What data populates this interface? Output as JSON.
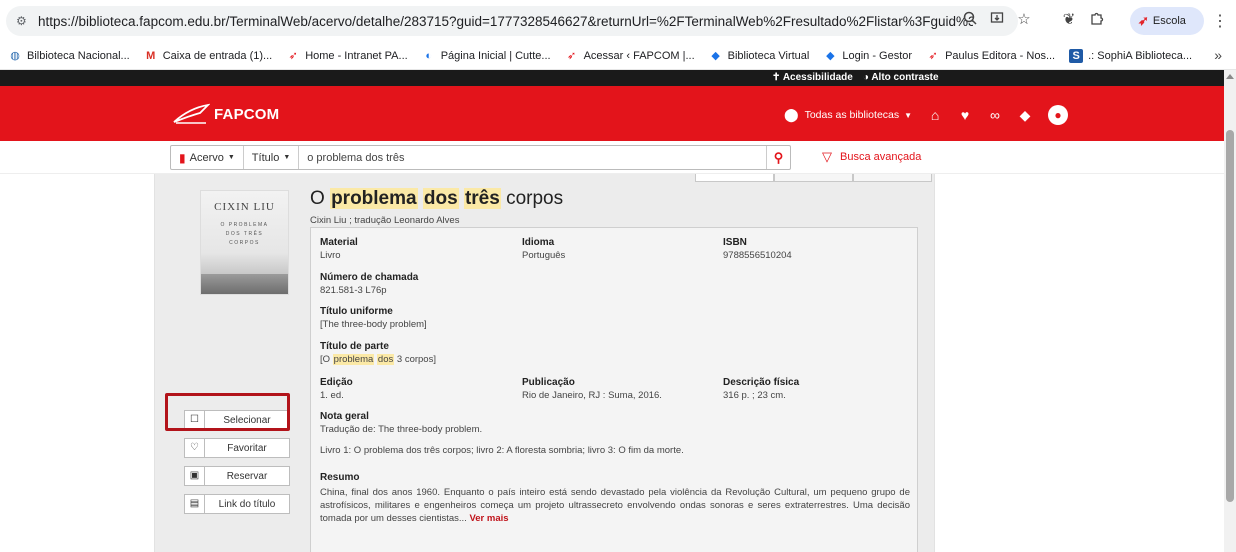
{
  "browser": {
    "url": "https://biblioteca.fapcom.edu.br/TerminalWeb/acervo/detalhe/283715?guid=1777328546627&returnUrl=%2FTerminalWeb%2Fresultado%2Flistar%3Fguid%3d177732854662...",
    "profile_label": "Escola",
    "icons": [
      "tune-icon",
      "zoom-icon",
      "install-icon",
      "star-icon",
      "extensions-icon",
      "puzzle-icon",
      "menu-kebab-icon"
    ]
  },
  "bookmarks": [
    {
      "label": "Bilbioteca Nacional...",
      "icon": "globe-icon",
      "color": "#2b6cb0"
    },
    {
      "label": "Caixa de entrada (1)...",
      "icon": "gmail-icon",
      "color": "#d93025"
    },
    {
      "label": "Home - Intranet PA...",
      "icon": "fapcom-icon",
      "color": "#e3141b"
    },
    {
      "label": "Página Inicial | Cutte...",
      "icon": "cutter-icon",
      "color": "#1a73e8"
    },
    {
      "label": "Acessar ‹ FAPCOM |...",
      "icon": "fapcom-icon",
      "color": "#e3141b"
    },
    {
      "label": "Biblioteca Virtual",
      "icon": "diamond-icon",
      "color": "#1a73e8"
    },
    {
      "label": "Login - Gestor",
      "icon": "diamond-icon",
      "color": "#1a73e8"
    },
    {
      "label": "Paulus Editora - Nos...",
      "icon": "fapcom-icon",
      "color": "#e3141b"
    },
    {
      "label": ".: SophiA Biblioteca...",
      "icon": "sophia-icon",
      "color": "#1f5aa6"
    }
  ],
  "top_bar": {
    "accessibility": "Acessibilidade",
    "high_contrast": "Alto contraste"
  },
  "header": {
    "logo_text": "FAPCOM",
    "library_select": "Todas as bibliotecas",
    "brand_color": "#e3141b"
  },
  "search": {
    "scope": "Acervo",
    "field": "Título",
    "query": "o problema dos três",
    "advanced": "Busca avançada"
  },
  "record": {
    "title_parts": [
      {
        "text": "problema",
        "highlight": true
      },
      {
        "text": "dos",
        "highlight": true
      },
      {
        "text": "três",
        "highlight": true
      }
    ],
    "title_prefix": "O",
    "title_suffix": "corpos",
    "authors": "Cixin Liu ; tradução Leonardo Alves",
    "cover": {
      "author": "CIXIN LIU",
      "title_lines": [
        "O PROBLEMA",
        "DOS TRÊS",
        "CORPOS"
      ]
    },
    "fields": {
      "material_label": "Material",
      "material": "Livro",
      "idioma_label": "Idioma",
      "idioma": "Português",
      "isbn_label": "ISBN",
      "isbn": "9788556510204",
      "chamada_label": "Número de chamada",
      "chamada": "821.581-3 L76p",
      "uniforme_label": "Título uniforme",
      "uniforme": "[The three-body problem]",
      "parte_label": "Título de parte",
      "parte_open": "[O",
      "parte_hl1": "problema",
      "parte_hl2": "dos",
      "parte_close": "3 corpos]",
      "edicao_label": "Edição",
      "edicao": "1. ed.",
      "publicacao_label": "Publicação",
      "publicacao": "Rio de Janeiro, RJ : Suma, 2016.",
      "descricao_label": "Descrição física",
      "descricao": "316 p. ; 23 cm.",
      "nota_label": "Nota geral",
      "nota1": "Tradução de: The three-body problem.",
      "nota2": "Livro 1: O problema dos três corpos; livro 2: A floresta sombria; livro 3: O fim da morte.",
      "resumo_label": "Resumo",
      "resumo": "China, final dos anos 1960. Enquanto o país inteiro está sendo devastado pela violência da Revolução Cultural, um pequeno grupo de astrofísicos, militares e engenheiros começa um projeto ultrassecreto envolvendo ondas sonoras e seres extraterrestres. Uma decisão tomada por um desses cientistas...",
      "ver_mais": "Ver mais"
    }
  },
  "actions": [
    {
      "label": "Selecionar",
      "icon": "checkbox-icon"
    },
    {
      "label": "Favoritar",
      "icon": "heart-icon"
    },
    {
      "label": "Reservar",
      "icon": "calendar-icon"
    },
    {
      "label": "Link do título",
      "icon": "link-icon"
    }
  ]
}
